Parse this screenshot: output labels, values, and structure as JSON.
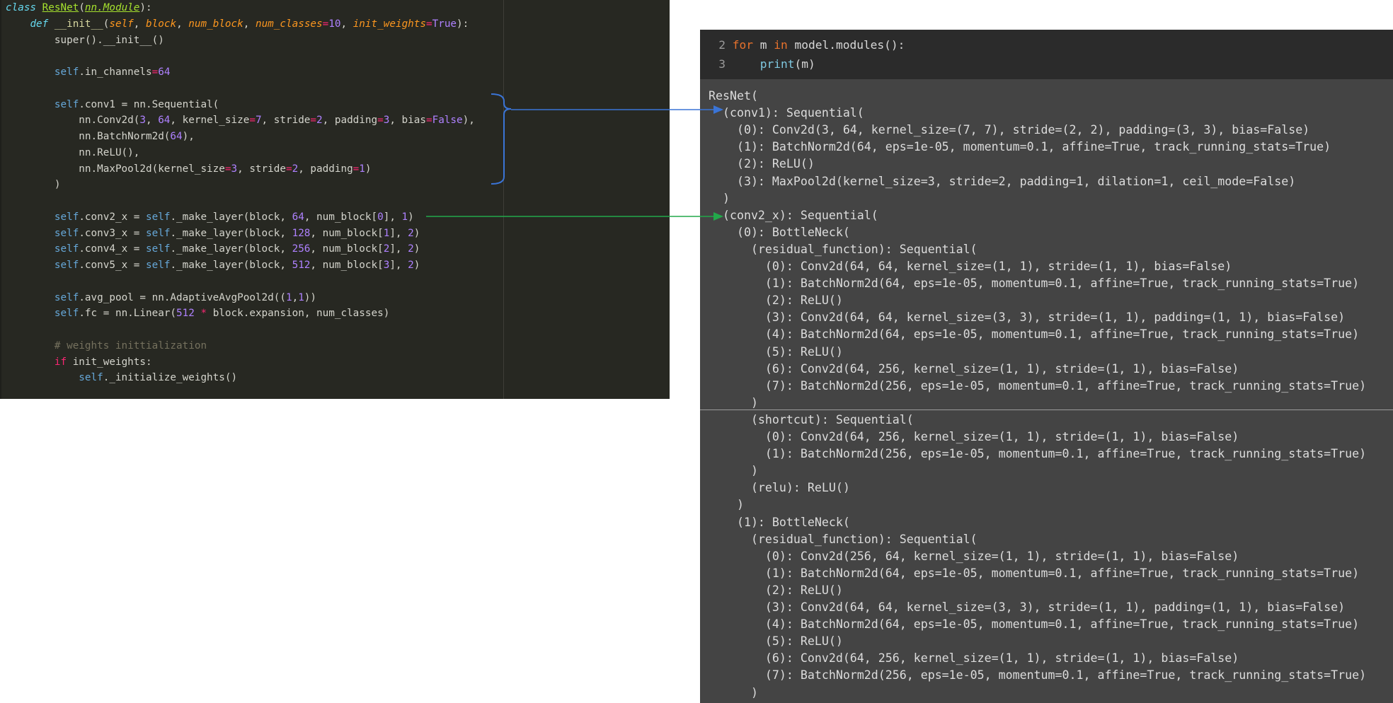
{
  "editor": {
    "lines": [
      {
        "indent": "",
        "tokens": [
          [
            "c-kw",
            "class "
          ],
          [
            "c-class",
            "ResNet"
          ],
          [
            "c-plain",
            "("
          ],
          [
            "c-base",
            "nn.Module"
          ],
          [
            "c-plain",
            "):"
          ]
        ]
      },
      {
        "indent": "    ",
        "tokens": [
          [
            "c-kw",
            "def "
          ],
          [
            "c-func",
            "__init__"
          ],
          [
            "c-plain",
            "("
          ],
          [
            "c-param",
            "self"
          ],
          [
            "c-plain",
            ", "
          ],
          [
            "c-param",
            "block"
          ],
          [
            "c-plain",
            ", "
          ],
          [
            "c-param",
            "num_block"
          ],
          [
            "c-plain",
            ", "
          ],
          [
            "c-param",
            "num_classes"
          ],
          [
            "c-op",
            "="
          ],
          [
            "c-num",
            "10"
          ],
          [
            "c-plain",
            ", "
          ],
          [
            "c-param",
            "init_weights"
          ],
          [
            "c-op",
            "="
          ],
          [
            "c-const",
            "True"
          ],
          [
            "c-plain",
            "):"
          ]
        ]
      },
      {
        "indent": "        ",
        "tokens": [
          [
            "c-plain",
            "super().__init__()"
          ]
        ]
      },
      {
        "indent": "",
        "tokens": []
      },
      {
        "indent": "        ",
        "tokens": [
          [
            "c-self",
            "self"
          ],
          [
            "c-plain",
            ".in_channels"
          ],
          [
            "c-op",
            "="
          ],
          [
            "c-num",
            "64"
          ]
        ]
      },
      {
        "indent": "",
        "tokens": []
      },
      {
        "indent": "        ",
        "tokens": [
          [
            "c-self",
            "self"
          ],
          [
            "c-plain",
            ".conv1 = nn.Sequential("
          ]
        ]
      },
      {
        "indent": "            ",
        "tokens": [
          [
            "c-plain",
            "nn.Conv2d("
          ],
          [
            "c-num",
            "3"
          ],
          [
            "c-plain",
            ", "
          ],
          [
            "c-num",
            "64"
          ],
          [
            "c-plain",
            ", kernel_size"
          ],
          [
            "c-op",
            "="
          ],
          [
            "c-num",
            "7"
          ],
          [
            "c-plain",
            ", stride"
          ],
          [
            "c-op",
            "="
          ],
          [
            "c-num",
            "2"
          ],
          [
            "c-plain",
            ", padding"
          ],
          [
            "c-op",
            "="
          ],
          [
            "c-num",
            "3"
          ],
          [
            "c-plain",
            ", bias"
          ],
          [
            "c-op",
            "="
          ],
          [
            "c-const",
            "False"
          ],
          [
            "c-plain",
            "),"
          ]
        ]
      },
      {
        "indent": "            ",
        "tokens": [
          [
            "c-plain",
            "nn.BatchNorm2d("
          ],
          [
            "c-num",
            "64"
          ],
          [
            "c-plain",
            "),"
          ]
        ]
      },
      {
        "indent": "            ",
        "tokens": [
          [
            "c-plain",
            "nn.ReLU(),"
          ]
        ]
      },
      {
        "indent": "            ",
        "tokens": [
          [
            "c-plain",
            "nn.MaxPool2d(kernel_size"
          ],
          [
            "c-op",
            "="
          ],
          [
            "c-num",
            "3"
          ],
          [
            "c-plain",
            ", stride"
          ],
          [
            "c-op",
            "="
          ],
          [
            "c-num",
            "2"
          ],
          [
            "c-plain",
            ", padding"
          ],
          [
            "c-op",
            "="
          ],
          [
            "c-num",
            "1"
          ],
          [
            "c-plain",
            ")"
          ]
        ]
      },
      {
        "indent": "        ",
        "tokens": [
          [
            "c-plain",
            ")"
          ]
        ]
      },
      {
        "indent": "",
        "tokens": []
      },
      {
        "indent": "        ",
        "tokens": [
          [
            "c-self",
            "self"
          ],
          [
            "c-plain",
            ".conv2_x = "
          ],
          [
            "c-self",
            "self"
          ],
          [
            "c-plain",
            "._make_layer(block, "
          ],
          [
            "c-num",
            "64"
          ],
          [
            "c-plain",
            ", num_block["
          ],
          [
            "c-num",
            "0"
          ],
          [
            "c-plain",
            "], "
          ],
          [
            "c-num",
            "1"
          ],
          [
            "c-plain",
            ")"
          ]
        ]
      },
      {
        "indent": "        ",
        "tokens": [
          [
            "c-self",
            "self"
          ],
          [
            "c-plain",
            ".conv3_x = "
          ],
          [
            "c-self",
            "self"
          ],
          [
            "c-plain",
            "._make_layer(block, "
          ],
          [
            "c-num",
            "128"
          ],
          [
            "c-plain",
            ", num_block["
          ],
          [
            "c-num",
            "1"
          ],
          [
            "c-plain",
            "], "
          ],
          [
            "c-num",
            "2"
          ],
          [
            "c-plain",
            ")"
          ]
        ]
      },
      {
        "indent": "        ",
        "tokens": [
          [
            "c-self",
            "self"
          ],
          [
            "c-plain",
            ".conv4_x = "
          ],
          [
            "c-self",
            "self"
          ],
          [
            "c-plain",
            "._make_layer(block, "
          ],
          [
            "c-num",
            "256"
          ],
          [
            "c-plain",
            ", num_block["
          ],
          [
            "c-num",
            "2"
          ],
          [
            "c-plain",
            "], "
          ],
          [
            "c-num",
            "2"
          ],
          [
            "c-plain",
            ")"
          ]
        ]
      },
      {
        "indent": "        ",
        "tokens": [
          [
            "c-self",
            "self"
          ],
          [
            "c-plain",
            ".conv5_x = "
          ],
          [
            "c-self",
            "self"
          ],
          [
            "c-plain",
            "._make_layer(block, "
          ],
          [
            "c-num",
            "512"
          ],
          [
            "c-plain",
            ", num_block["
          ],
          [
            "c-num",
            "3"
          ],
          [
            "c-plain",
            "], "
          ],
          [
            "c-num",
            "2"
          ],
          [
            "c-plain",
            ")"
          ]
        ]
      },
      {
        "indent": "",
        "tokens": []
      },
      {
        "indent": "        ",
        "tokens": [
          [
            "c-self",
            "self"
          ],
          [
            "c-plain",
            ".avg_pool = nn.AdaptiveAvgPool2d(("
          ],
          [
            "c-num",
            "1"
          ],
          [
            "c-plain",
            ","
          ],
          [
            "c-num",
            "1"
          ],
          [
            "c-plain",
            "))"
          ]
        ]
      },
      {
        "indent": "        ",
        "tokens": [
          [
            "c-self",
            "self"
          ],
          [
            "c-plain",
            ".fc = nn.Linear("
          ],
          [
            "c-num",
            "512"
          ],
          [
            "c-plain",
            " "
          ],
          [
            "c-op",
            "*"
          ],
          [
            "c-plain",
            " block.expansion, num_classes)"
          ]
        ]
      },
      {
        "indent": "",
        "tokens": []
      },
      {
        "indent": "        ",
        "tokens": [
          [
            "c-cmt",
            "# weights inittialization"
          ]
        ]
      },
      {
        "indent": "        ",
        "tokens": [
          [
            "c-ctrl",
            "if "
          ],
          [
            "c-plain",
            "init_weights:"
          ]
        ]
      },
      {
        "indent": "            ",
        "tokens": [
          [
            "c-self",
            "self"
          ],
          [
            "c-plain",
            "._initialize_weights()"
          ]
        ]
      }
    ]
  },
  "cell_input": {
    "lines": [
      {
        "number": "2",
        "tokens": [
          [
            "in-kw",
            "for "
          ],
          [
            "in-plain",
            "m "
          ],
          [
            "in-kw",
            "in "
          ],
          [
            "in-plain",
            "model.modules():"
          ]
        ]
      },
      {
        "number": "3",
        "tokens": [
          [
            "in-plain",
            "    "
          ],
          [
            "in-fn",
            "print"
          ],
          [
            "in-plain",
            "(m)"
          ]
        ]
      }
    ]
  },
  "output": {
    "lines": [
      "ResNet(",
      "  (conv1): Sequential(",
      "    (0): Conv2d(3, 64, kernel_size=(7, 7), stride=(2, 2), padding=(3, 3), bias=False)",
      "    (1): BatchNorm2d(64, eps=1e-05, momentum=0.1, affine=True, track_running_stats=True)",
      "    (2): ReLU()",
      "    (3): MaxPool2d(kernel_size=3, stride=2, padding=1, dilation=1, ceil_mode=False)",
      "  )",
      "  (conv2_x): Sequential(",
      "    (0): BottleNeck(",
      "      (residual_function): Sequential(",
      "        (0): Conv2d(64, 64, kernel_size=(1, 1), stride=(1, 1), bias=False)",
      "        (1): BatchNorm2d(64, eps=1e-05, momentum=0.1, affine=True, track_running_stats=True)",
      "        (2): ReLU()",
      "        (3): Conv2d(64, 64, kernel_size=(3, 3), stride=(1, 1), padding=(1, 1), bias=False)",
      "        (4): BatchNorm2d(64, eps=1e-05, momentum=0.1, affine=True, track_running_stats=True)",
      "        (5): ReLU()",
      "        (6): Conv2d(64, 256, kernel_size=(1, 1), stride=(1, 1), bias=False)",
      "        (7): BatchNorm2d(256, eps=1e-05, momentum=0.1, affine=True, track_running_stats=True)",
      "      )",
      "      (shortcut): Sequential(",
      "        (0): Conv2d(64, 256, kernel_size=(1, 1), stride=(1, 1), bias=False)",
      "        (1): BatchNorm2d(256, eps=1e-05, momentum=0.1, affine=True, track_running_stats=True)",
      "      )",
      "      (relu): ReLU()",
      "    )",
      "    (1): BottleNeck(",
      "      (residual_function): Sequential(",
      "        (0): Conv2d(256, 64, kernel_size=(1, 1), stride=(1, 1), bias=False)",
      "        (1): BatchNorm2d(64, eps=1e-05, momentum=0.1, affine=True, track_running_stats=True)",
      "        (2): ReLU()",
      "        (3): Conv2d(64, 64, kernel_size=(3, 3), stride=(1, 1), padding=(1, 1), bias=False)",
      "        (4): BatchNorm2d(64, eps=1e-05, momentum=0.1, affine=True, track_running_stats=True)",
      "        (5): ReLU()",
      "        (6): Conv2d(64, 256, kernel_size=(1, 1), stride=(1, 1), bias=False)",
      "        (7): BatchNorm2d(256, eps=1e-05, momentum=0.1, affine=True, track_running_stats=True)",
      "      )"
    ]
  },
  "annotations": {
    "conv1_arrow_color": "#3a74d6",
    "conv2_arrow_color": "#22a84a"
  }
}
